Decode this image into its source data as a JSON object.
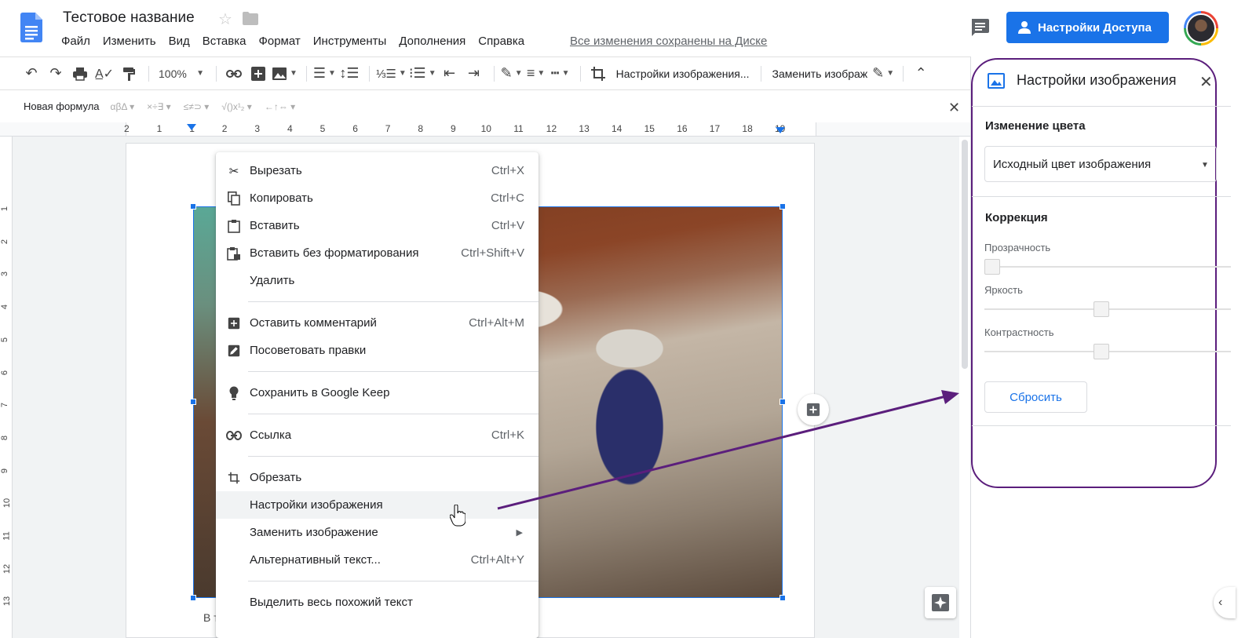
{
  "header": {
    "doc_title": "Тестовое название",
    "menu": [
      "Файл",
      "Изменить",
      "Вид",
      "Вставка",
      "Формат",
      "Инструменты",
      "Дополнения",
      "Справка"
    ],
    "saved_status": "Все изменения сохранены на Диске",
    "share_label": "Настройки Доступа",
    "brand_color": "#1a73e8"
  },
  "toolbar": {
    "zoom": "100%",
    "image_options": "Настройки изображения...",
    "replace_image": "Заменить изображ"
  },
  "equation_bar": {
    "new_formula": "Новая формула",
    "groups": [
      "αβΔ",
      "×÷∃",
      "≤≠⊃",
      "√()x¹₂",
      "←↑⇔"
    ]
  },
  "ruler": {
    "horizontal": [
      "2",
      "1",
      "1",
      "2",
      "3",
      "4",
      "5",
      "6",
      "7",
      "8",
      "9",
      "10",
      "11",
      "12",
      "13",
      "14",
      "15",
      "16",
      "17",
      "18",
      "19"
    ],
    "vertical": [
      "1",
      "2",
      "3",
      "4",
      "5",
      "6",
      "7",
      "8",
      "9",
      "10",
      "11",
      "12",
      "13"
    ]
  },
  "document": {
    "partial_text": "В т"
  },
  "context_menu": {
    "items": [
      {
        "label": "Вырезать",
        "shortcut": "Ctrl+X",
        "icon": "scissors-icon"
      },
      {
        "label": "Копировать",
        "shortcut": "Ctrl+C",
        "icon": "copy-icon"
      },
      {
        "label": "Вставить",
        "shortcut": "Ctrl+V",
        "icon": "paste-icon"
      },
      {
        "label": "Вставить без форматирования",
        "shortcut": "Ctrl+Shift+V",
        "icon": "paste-plain-icon"
      },
      {
        "label": "Удалить",
        "shortcut": "",
        "icon": ""
      },
      {
        "label": "Оставить комментарий",
        "shortcut": "Ctrl+Alt+M",
        "icon": "add-comment-icon"
      },
      {
        "label": "Посоветовать правки",
        "shortcut": "",
        "icon": "suggest-edit-icon"
      },
      {
        "label": "Сохранить в Google Keep",
        "shortcut": "",
        "icon": "lightbulb-icon"
      },
      {
        "label": "Ссылка",
        "shortcut": "Ctrl+K",
        "icon": "link-icon"
      },
      {
        "label": "Обрезать",
        "shortcut": "",
        "icon": "crop-icon"
      },
      {
        "label": "Настройки изображения",
        "shortcut": "",
        "icon": ""
      },
      {
        "label": "Заменить изображение",
        "shortcut": "",
        "icon": ""
      },
      {
        "label": "Альтернативный текст...",
        "shortcut": "Ctrl+Alt+Y",
        "icon": ""
      },
      {
        "label": "Выделить весь похожий текст",
        "shortcut": "",
        "icon": ""
      }
    ]
  },
  "side_panel": {
    "title": "Настройки изображения",
    "recolor_heading": "Изменение цвета",
    "recolor_value": "Исходный цвет изображения",
    "adjust_heading": "Коррекция",
    "transparency_label": "Прозрачность",
    "brightness_label": "Яркость",
    "contrast_label": "Контрастность",
    "transparency_value": 0,
    "brightness_value": 0.5,
    "contrast_value": 0.5,
    "reset_label": "Сбросить",
    "highlight_color": "#5b1e7c"
  }
}
